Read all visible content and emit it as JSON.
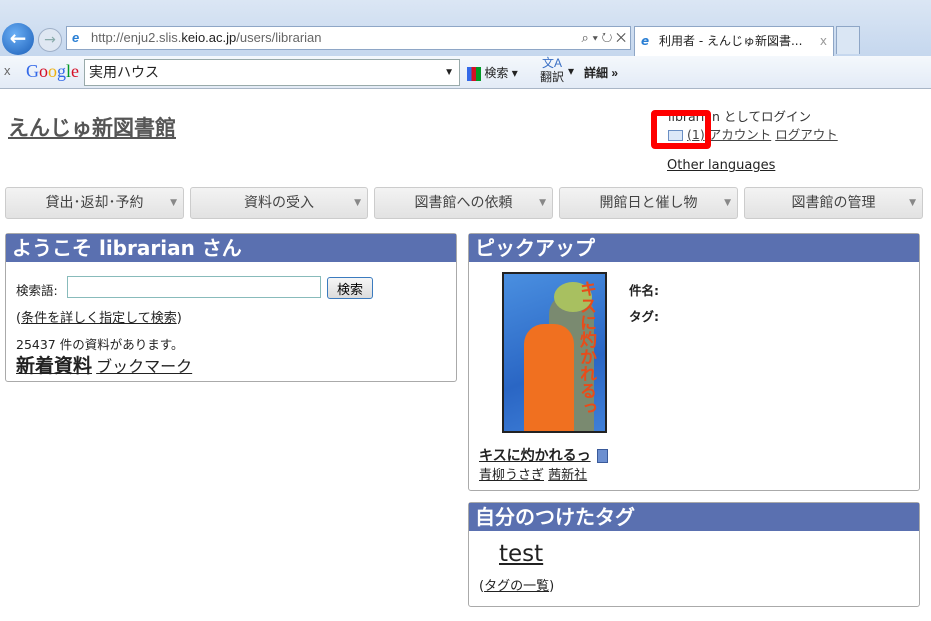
{
  "browser": {
    "url_prefix": "http://enju2.slis.",
    "url_host": "keio.ac.jp",
    "url_path": "/users/librarian",
    "tab_title": "利用者 - えんじゅ新図書...",
    "tab_close": "x",
    "address_tools": "⌕ ▾ ↻ ✕"
  },
  "google_toolbar": {
    "close": "x",
    "logo": "Google",
    "query": "実用ハウス",
    "search_label": "検索",
    "translate_label": "翻訳",
    "more_label": "詳細 »"
  },
  "site": {
    "title": "えんじゅ新図書館"
  },
  "user": {
    "login_text": "librarian としてログイン",
    "messages": "(1)",
    "account": "アカウント",
    "logout": "ログアウト",
    "other_languages": "Other languages"
  },
  "menu": [
    "貸出･返却･予約",
    "資料の受入",
    "図書館への依頼",
    "開館日と催し物",
    "図書館の管理"
  ],
  "welcome": {
    "title": "ようこそ librarian さん",
    "search_label": "検索語:",
    "search_value": "",
    "search_button": "検索",
    "advanced_open": "(",
    "advanced": "条件を詳しく指定して検索",
    "advanced_close": ")",
    "count": "25437",
    "count_suffix": " 件の資料があります。",
    "new_items": "新着資料",
    "bookmark": "ブックマーク"
  },
  "pickup": {
    "title": "ピックアップ",
    "cover_text": "キスに灼かれるっ",
    "book_title": "キスに灼かれるっ",
    "author": "青柳うさぎ",
    "publisher": "茜新社",
    "label_title": "件名:",
    "label_tags": "タグ:"
  },
  "tags": {
    "title": "自分のつけたタグ",
    "tag": "test",
    "list_open": "(",
    "list_link": "タグの一覧",
    "list_close": ")"
  }
}
